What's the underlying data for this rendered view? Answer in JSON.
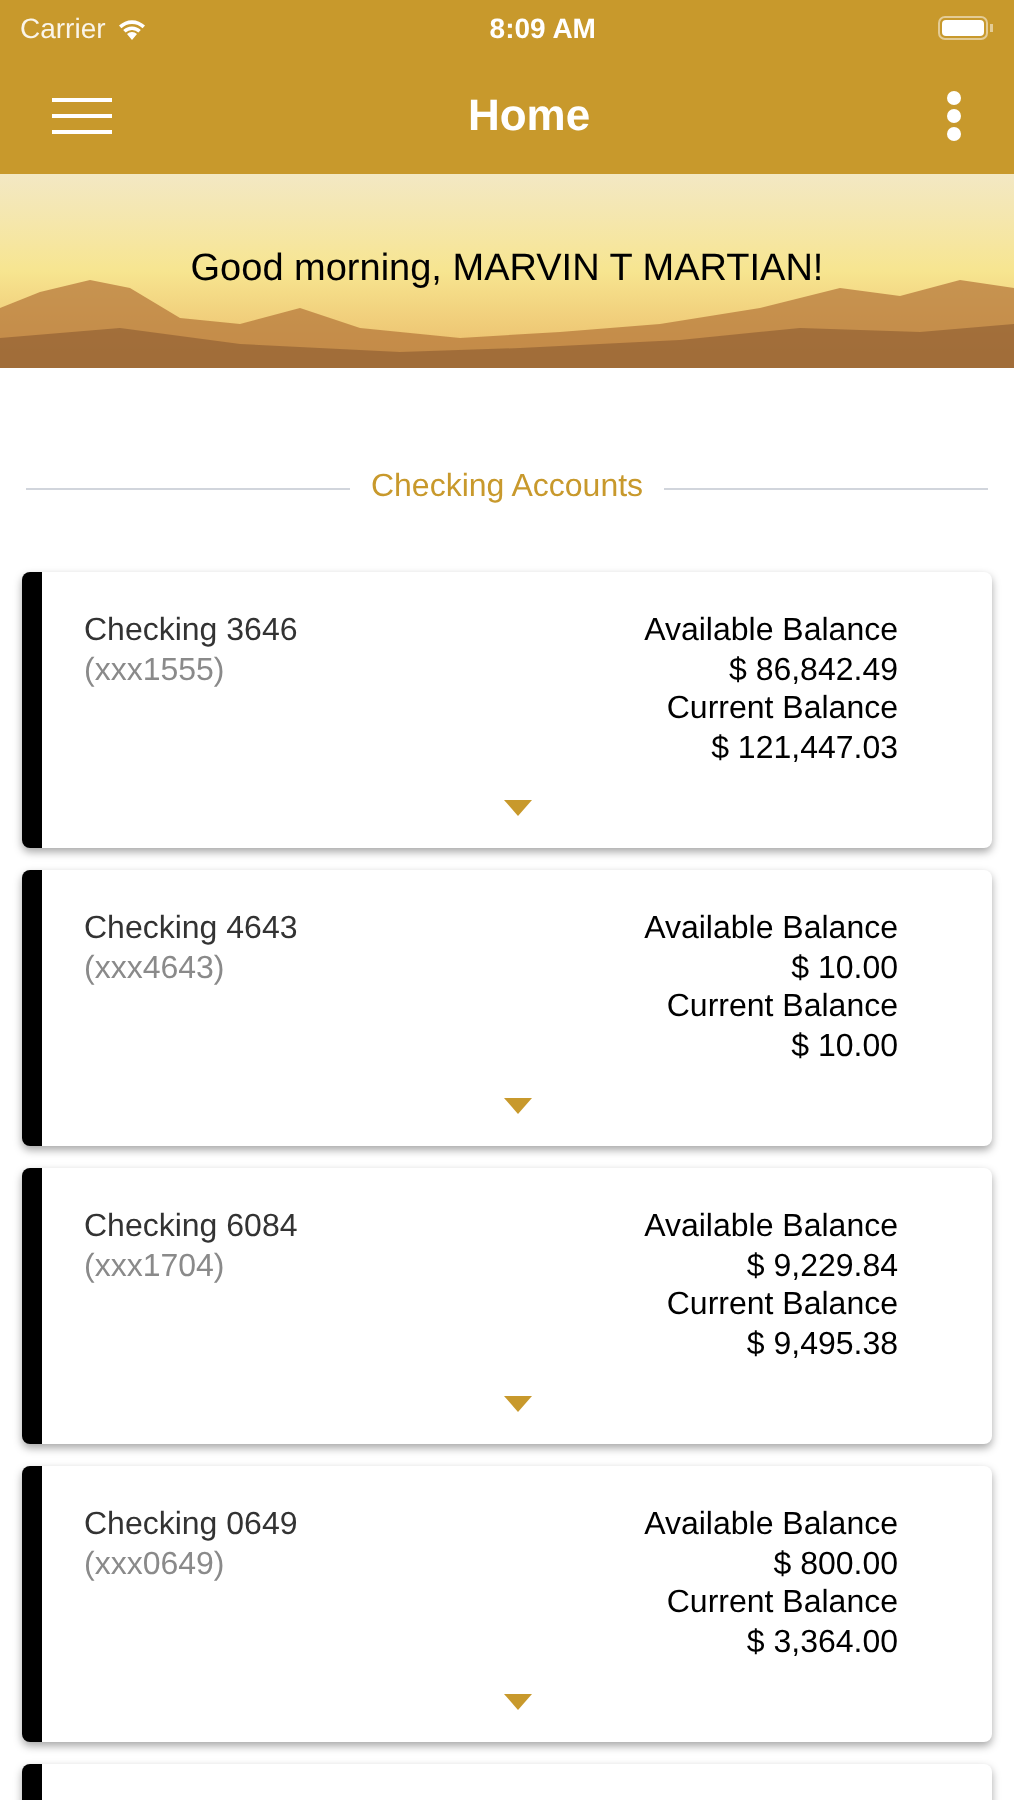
{
  "status_bar": {
    "carrier": "Carrier",
    "time": "8:09 AM"
  },
  "nav_bar": {
    "title": "Home"
  },
  "banner": {
    "greeting": "Good morning, MARVIN T MARTIAN!"
  },
  "section": {
    "title": "Checking Accounts"
  },
  "accounts": [
    {
      "name": "Checking 3646",
      "number": "(xxx1555)",
      "available_label": "Available Balance",
      "available": "$ 86,842.49",
      "current_label": "Current Balance",
      "current": "$ 121,447.03"
    },
    {
      "name": "Checking 4643",
      "number": "(xxx4643)",
      "available_label": "Available Balance",
      "available": "$ 10.00",
      "current_label": "Current Balance",
      "current": "$ 10.00"
    },
    {
      "name": "Checking 6084",
      "number": "(xxx1704)",
      "available_label": "Available Balance",
      "available": "$ 9,229.84",
      "current_label": "Current Balance",
      "current": "$ 9,495.38"
    },
    {
      "name": "Checking 0649",
      "number": "(xxx0649)",
      "available_label": "Available Balance",
      "available": "$ 800.00",
      "current_label": "Current Balance",
      "current": "$ 3,364.00"
    }
  ]
}
